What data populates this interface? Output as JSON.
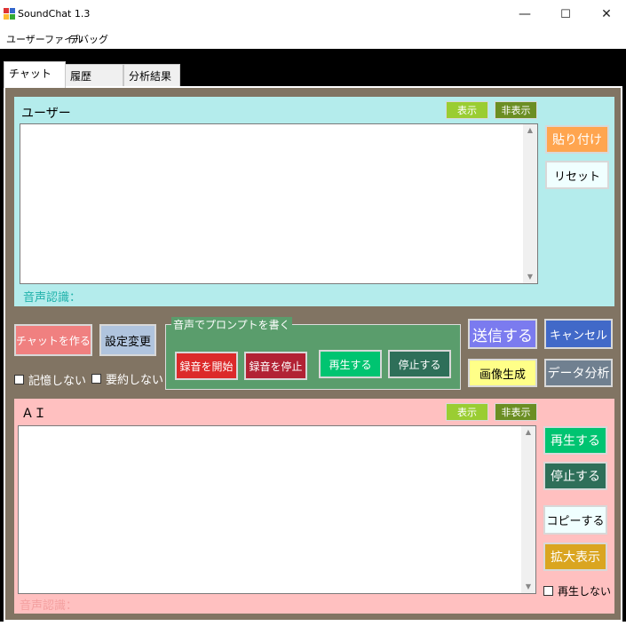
{
  "window": {
    "title": "SoundChat 1.3",
    "minimize_glyph": "—",
    "maximize_glyph": "☐",
    "close_glyph": "✕"
  },
  "menu": {
    "items": [
      "ユーザーファイル",
      "デバッグ"
    ]
  },
  "tabs": [
    {
      "label": "チャット",
      "active": true
    },
    {
      "label": "履歴",
      "active": false
    },
    {
      "label": "分析結果",
      "active": false
    }
  ],
  "user_panel": {
    "title": "ユーザー",
    "show_label": "表示",
    "hide_label": "非表示",
    "text_value": "",
    "voice_recognition_label": "音声認識：",
    "paste_label": "貼り付け",
    "reset_label": "リセット"
  },
  "controls": {
    "create_chat_label": "チャットを作る",
    "settings_label": "設定変更",
    "no_memory_label": "記憶しない",
    "no_summary_label": "要約しない",
    "voice_group_title": "音声でプロンプトを書く",
    "start_record_label": "録音を開始",
    "stop_record_label": "録音を停止",
    "play_label": "再生する",
    "stop_label": "停止する",
    "send_label": "送信する",
    "cancel_label": "キャンセル",
    "image_gen_label": "画像生成",
    "data_analysis_label": "データ分析"
  },
  "ai_panel": {
    "title": "ＡＩ",
    "show_label": "表示",
    "hide_label": "非表示",
    "text_value": "",
    "voice_recognition_label": "音声認識：",
    "play_label": "再生する",
    "stop_label": "停止する",
    "copy_label": "コピーする",
    "zoom_label": "拡大表示",
    "no_play_label": "再生しない"
  },
  "colors": {
    "tab_page_bg": "#817463",
    "user_panel_bg": "#b4ecec",
    "ai_panel_bg": "#ffc0c0",
    "voice_group_bg": "#5a9d6c",
    "show_button": "#9acd32",
    "hide_button": "#6b8e23",
    "paste_button": "#ffa54f",
    "create_chat_button": "#f08080",
    "settings_button": "#b0c4de",
    "start_record_button": "#dc2a2a",
    "stop_record_button": "#b22234",
    "play_button": "#00c471",
    "stop_button": "#2e6f59",
    "send_button": "#7b7bef",
    "cancel_button": "#4169c8",
    "image_gen_button": "#ffff88",
    "data_analysis_button": "#708090",
    "zoom_button": "#daa520",
    "copy_button": "#f0ffff"
  }
}
